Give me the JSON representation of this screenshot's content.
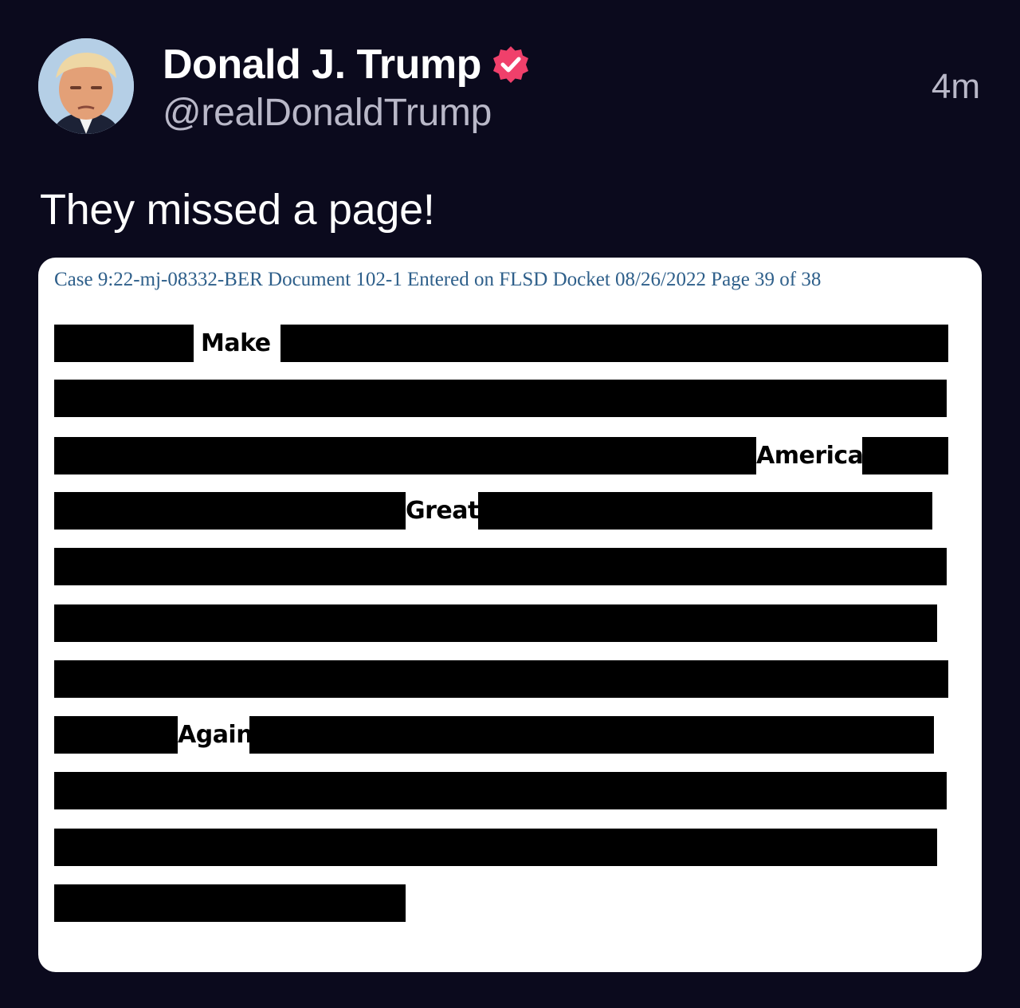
{
  "author": {
    "display_name": "Donald J. Trump",
    "handle": "@realDonaldTrump",
    "verified_icon": "verified-badge-icon",
    "avatar_icon": "avatar-photo"
  },
  "timestamp": "4m",
  "post": {
    "text": "They missed a page!"
  },
  "document": {
    "header": "Case 9:22-mj-08332-BER Document 102-1 Entered on FLSD Docket 08/26/2022 Page 39 of 38",
    "visible_words": [
      "Make",
      "America",
      "Great",
      "Again"
    ],
    "redaction_color": "#000000"
  },
  "colors": {
    "background": "#0b0a1d",
    "verified_badge": "#f0406b",
    "secondary_text": "#b9b8c8",
    "doc_header_text": "#2e5f8a"
  }
}
